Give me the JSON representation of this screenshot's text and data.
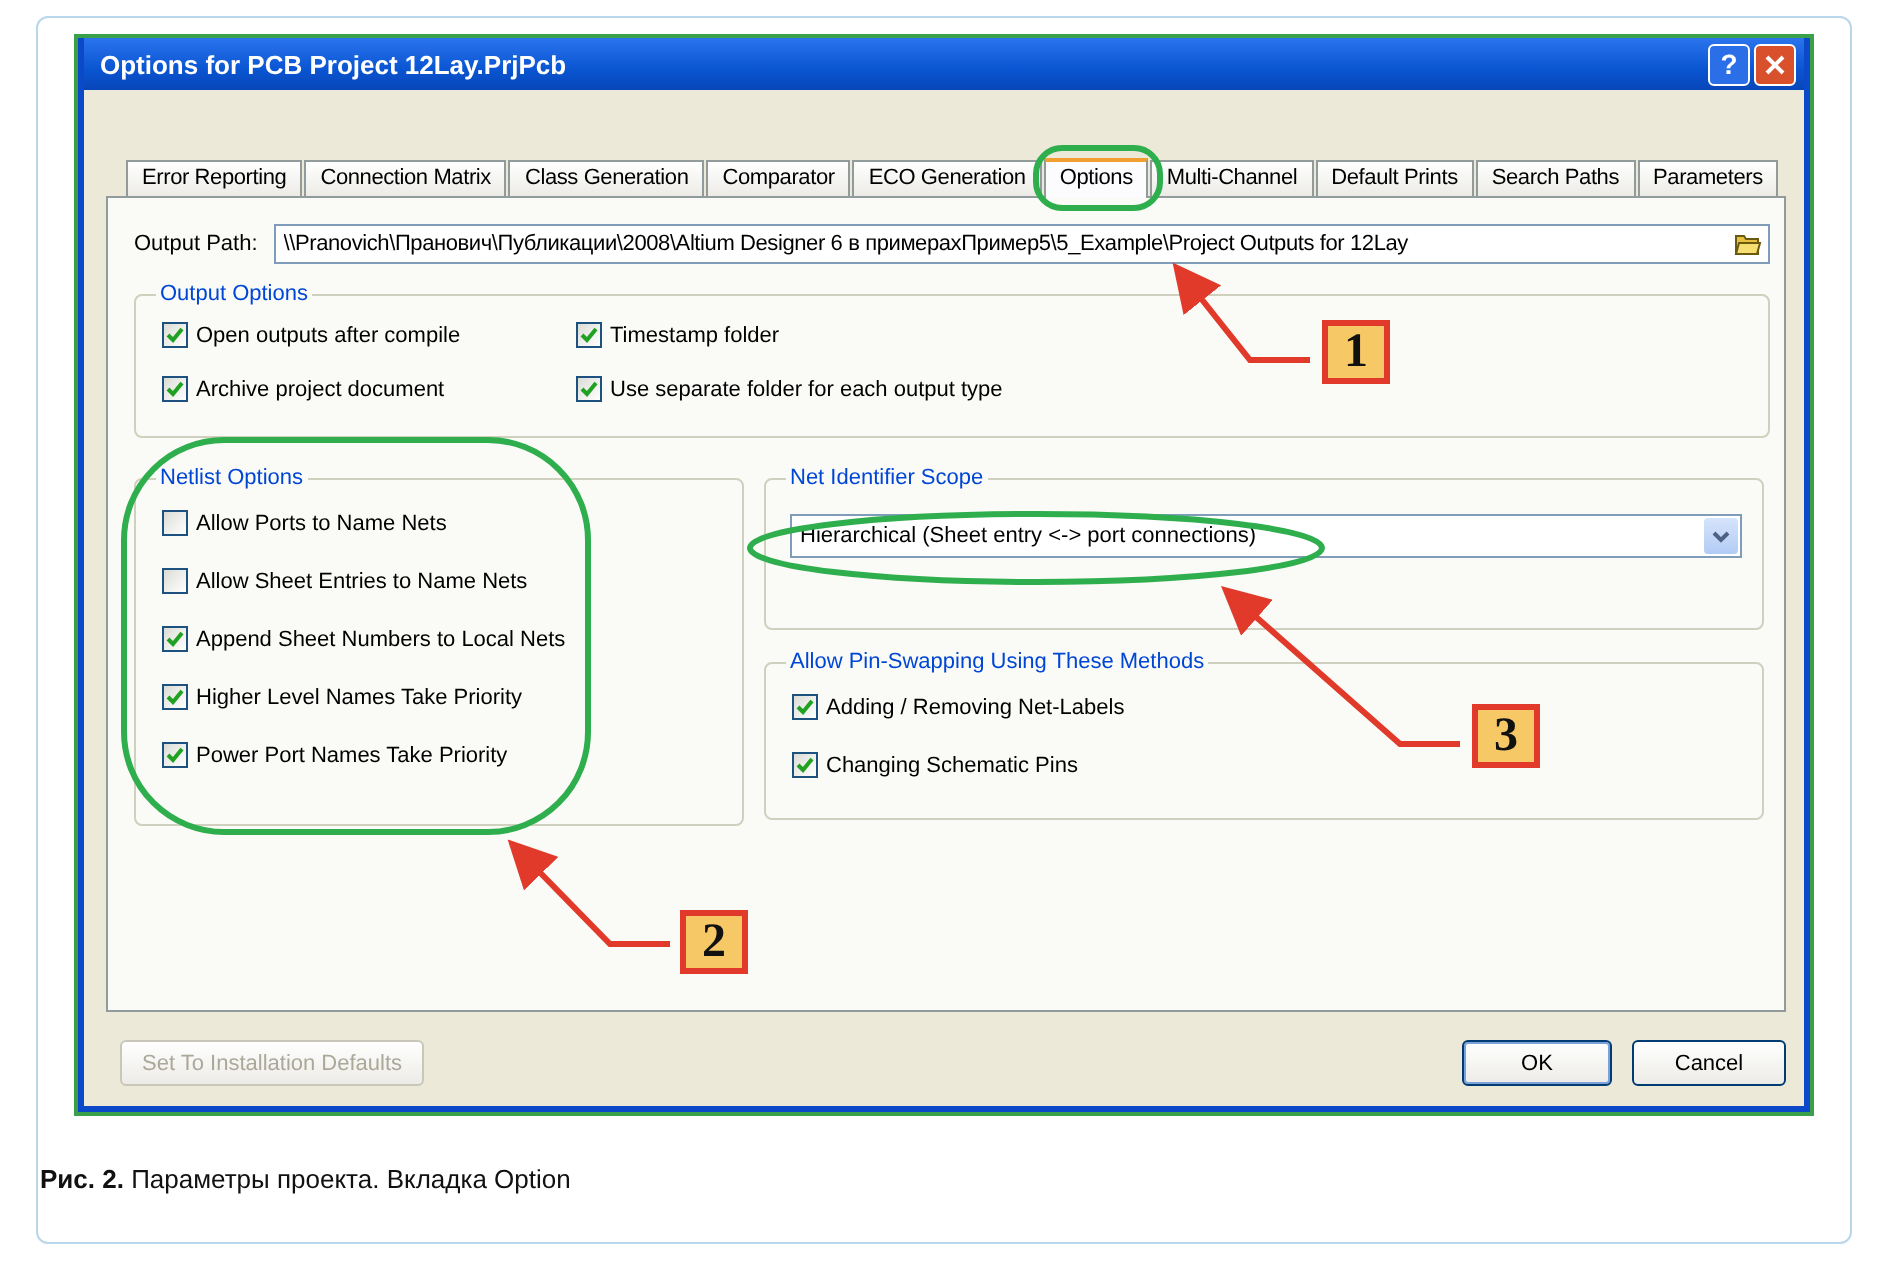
{
  "window": {
    "title": "Options for PCB Project 12Lay.PrjPcb",
    "help": "?"
  },
  "tabs": [
    {
      "label": "Error Reporting",
      "selected": false
    },
    {
      "label": "Connection Matrix",
      "selected": false
    },
    {
      "label": "Class Generation",
      "selected": false
    },
    {
      "label": "Comparator",
      "selected": false
    },
    {
      "label": "ECO Generation",
      "selected": false
    },
    {
      "label": "Options",
      "selected": true
    },
    {
      "label": "Multi-Channel",
      "selected": false
    },
    {
      "label": "Default Prints",
      "selected": false
    },
    {
      "label": "Search Paths",
      "selected": false
    },
    {
      "label": "Parameters",
      "selected": false
    }
  ],
  "output_path": {
    "label": "Output Path:",
    "value": "\\\\Pranovich\\Пранович\\Публикации\\2008\\Altium Designer 6 в примерахПример5\\5_Example\\Project Outputs for 12Lay"
  },
  "output_options": {
    "title": "Output Options",
    "items": [
      {
        "label": "Open outputs after compile",
        "checked": true
      },
      {
        "label": "Timestamp folder",
        "checked": true
      },
      {
        "label": "Archive project document",
        "checked": true
      },
      {
        "label": "Use separate folder for each output type",
        "checked": true
      }
    ]
  },
  "netlist_options": {
    "title": "Netlist Options",
    "items": [
      {
        "label": "Allow Ports to Name Nets",
        "checked": false
      },
      {
        "label": "Allow Sheet Entries to Name Nets",
        "checked": false
      },
      {
        "label": "Append Sheet Numbers to Local Nets",
        "checked": true
      },
      {
        "label": "Higher Level Names Take Priority",
        "checked": true
      },
      {
        "label": "Power Port Names Take Priority",
        "checked": true
      }
    ]
  },
  "net_identifier_scope": {
    "title": "Net Identifier Scope",
    "value": "Hierarchical (Sheet entry <-> port connections)"
  },
  "pin_swapping": {
    "title": "Allow Pin-Swapping Using These Methods",
    "items": [
      {
        "label": "Adding / Removing Net-Labels",
        "checked": true
      },
      {
        "label": "Changing Schematic Pins",
        "checked": true
      }
    ]
  },
  "buttons": [
    {
      "label": "Set To Installation Defaults",
      "disabled": true
    },
    {
      "label": "OK",
      "disabled": false
    },
    {
      "label": "Cancel",
      "disabled": false
    }
  ],
  "callouts": [
    "1",
    "2",
    "3"
  ],
  "caption": "**Рис. 2.** Параметры проекта. Вкладка Option"
}
